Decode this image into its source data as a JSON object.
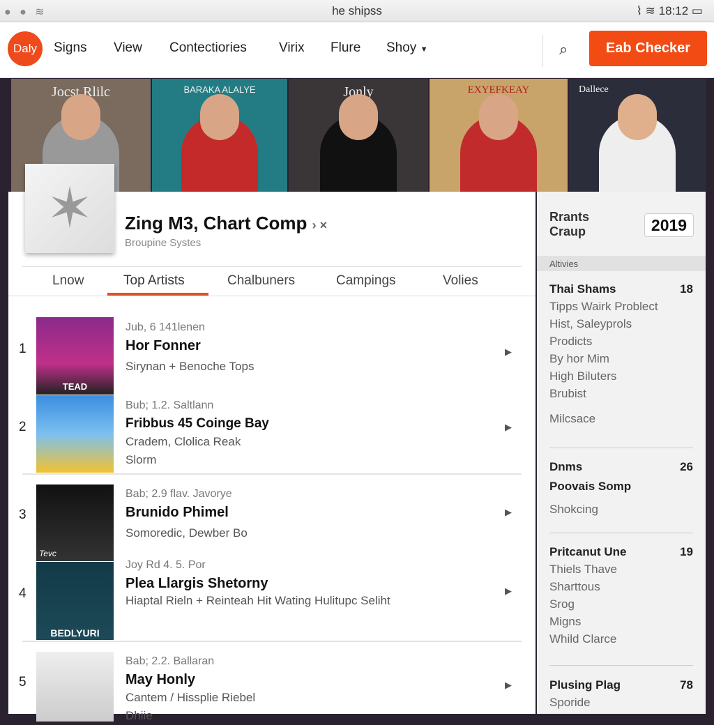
{
  "status": {
    "title": "he shipss",
    "time": "18:12",
    "icons": [
      "apple-icon",
      "wifi-icon",
      "battery-icon"
    ]
  },
  "nav": {
    "logo": "Daly",
    "items": [
      "Signs",
      "View",
      "Contectiories",
      "Virix",
      "Flure",
      "Shoy"
    ],
    "cta": "Eab Checker",
    "search_icon": "search-icon"
  },
  "banner": [
    "Jocst Rlilc",
    "BARAKA ALALYE",
    "Jonly",
    "EXYEFKEAY",
    "Dallece"
  ],
  "header": {
    "title": "Zing M3, Chart Comp",
    "subtitle": "Broupine Systes"
  },
  "tabs": [
    "Lnow",
    "Top Artists",
    "Chalbuners",
    "Campings",
    "Volies"
  ],
  "active_tab": "Top Artists",
  "accent": "#f24b13",
  "rows": [
    {
      "rank": "1",
      "meta": "Jub, 6  141lenen",
      "name": "Hor Fonner",
      "desc": "Sirynan + Benoche Tops",
      "art": "TEAD"
    },
    {
      "rank": "2",
      "meta": "Bub; 1.2. Saltlann",
      "name": "Fribbus 45 Coinge Bay",
      "desc": "Cradem, Clolica Reak Slorm",
      "art": ""
    },
    {
      "rank": "3",
      "meta": "Bab; 2.9 flav. Javorye",
      "name": "Brunido Phimel",
      "desc": "Somoredic, Dewber Bo",
      "art": "Tevc"
    },
    {
      "rank": "4",
      "meta": "Joy Rd 4. 5. Por",
      "name": "Plea Llargis Shetorny",
      "desc": "Hiaptal Rieln + Reinteah Hit Wating Hulitupc Seliht",
      "art": "BEDLYURI"
    },
    {
      "rank": "5",
      "meta": "Bab; 2.2. Ballaran",
      "name": "May Honly",
      "desc": "Cantem / Hissplie Riebel Dhiie",
      "art": ""
    }
  ],
  "sidebar": {
    "heading": "Rrants Craup",
    "year": "2019",
    "section": "Altivies",
    "groups": [
      {
        "title": "Thai Shams",
        "count": "18",
        "items": [
          "Tipps Wairk Problect",
          "Hist, Saleyprols",
          "Prodicts",
          "By hor Mim",
          "High Biluters",
          "Brubist",
          "Milcsace"
        ]
      },
      {
        "title": "Dnms",
        "count": "26",
        "items": [
          "Poovais Somp",
          "Shokcing"
        ]
      },
      {
        "title": "Pritcanut Une",
        "count": "19",
        "items": [
          "Thiels Thave",
          "Sharttous",
          "Srog",
          "Migns",
          "Whild Clarce"
        ]
      },
      {
        "title": "Plusing Plag",
        "count": "78",
        "items": [
          "Sporide"
        ]
      }
    ]
  }
}
